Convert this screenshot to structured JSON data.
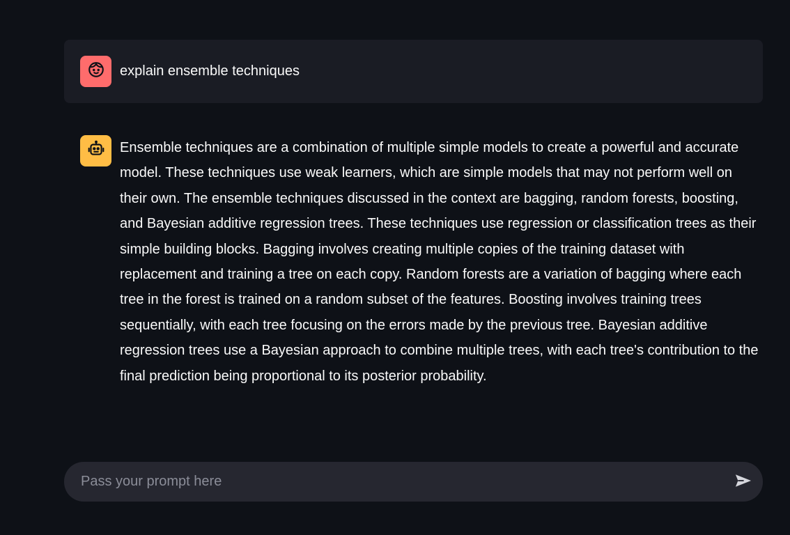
{
  "chat": {
    "messages": [
      {
        "role": "user",
        "avatar_icon": "user-face-icon",
        "avatar_color": "#ff6c6c",
        "text": "explain ensemble techniques"
      },
      {
        "role": "assistant",
        "avatar_icon": "robot-icon",
        "avatar_color": "#ffbd45",
        "text": "Ensemble techniques are a combination of multiple simple models to create a powerful and accurate model. These techniques use weak learners, which are simple models that may not perform well on their own. The ensemble techniques discussed in the context are bagging, random forests, boosting, and Bayesian additive regression trees. These techniques use regression or classification trees as their simple building blocks. Bagging involves creating multiple copies of the training dataset with replacement and training a tree on each copy. Random forests are a variation of bagging where each tree in the forest is trained on a random subset of the features. Boosting involves training trees sequentially, with each tree focusing on the errors made by the previous tree. Bayesian additive regression trees use a Bayesian approach to combine multiple trees, with each tree's contribution to the final prediction being proportional to its posterior probability."
      }
    ]
  },
  "prompt": {
    "placeholder": "Pass your prompt here",
    "value": "",
    "send_icon": "send-icon"
  },
  "theme": {
    "background": "#0e1117",
    "user_bubble": "#1a1c24",
    "input_background": "#262730"
  }
}
